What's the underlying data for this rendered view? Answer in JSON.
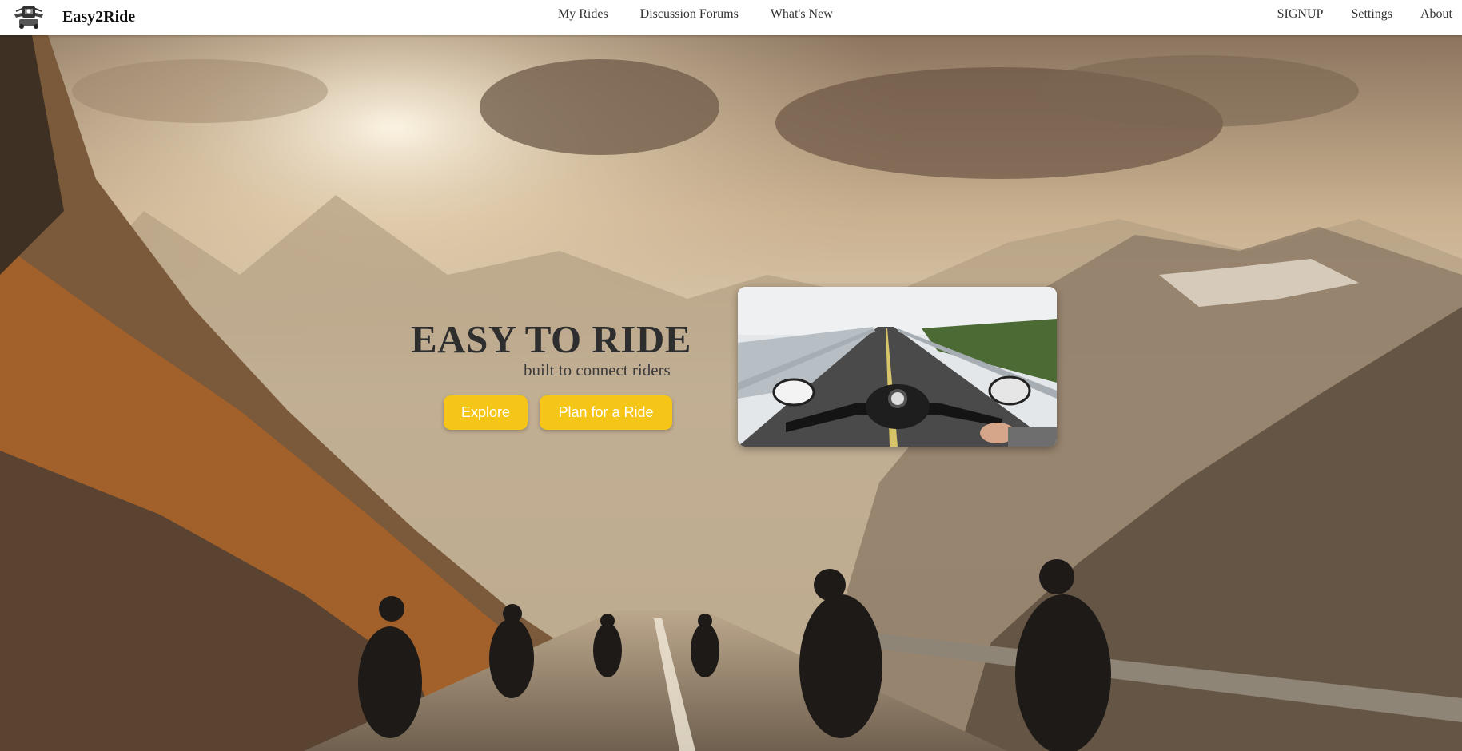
{
  "app": {
    "brand_name": "Easy2Ride",
    "logo_icon": "motorcycle-logo-icon"
  },
  "nav": {
    "center_links": [
      "My Rides",
      "Discussion Forums",
      "What's New"
    ],
    "right_links": [
      "SIGNUP",
      "Settings",
      "About"
    ]
  },
  "hero": {
    "title": "EASY TO RIDE",
    "subtitle": "built to connect riders",
    "explore_label": "Explore",
    "plan_label": "Plan for a Ride",
    "background_image": "motorcycle riders on a mountain road at sunset",
    "preview_image": "first-person motorcycle handlebar view on a highway"
  },
  "colors": {
    "accent": "#f5c518",
    "title_text": "#2e2e2e",
    "navbar_bg": "#ffffff"
  }
}
